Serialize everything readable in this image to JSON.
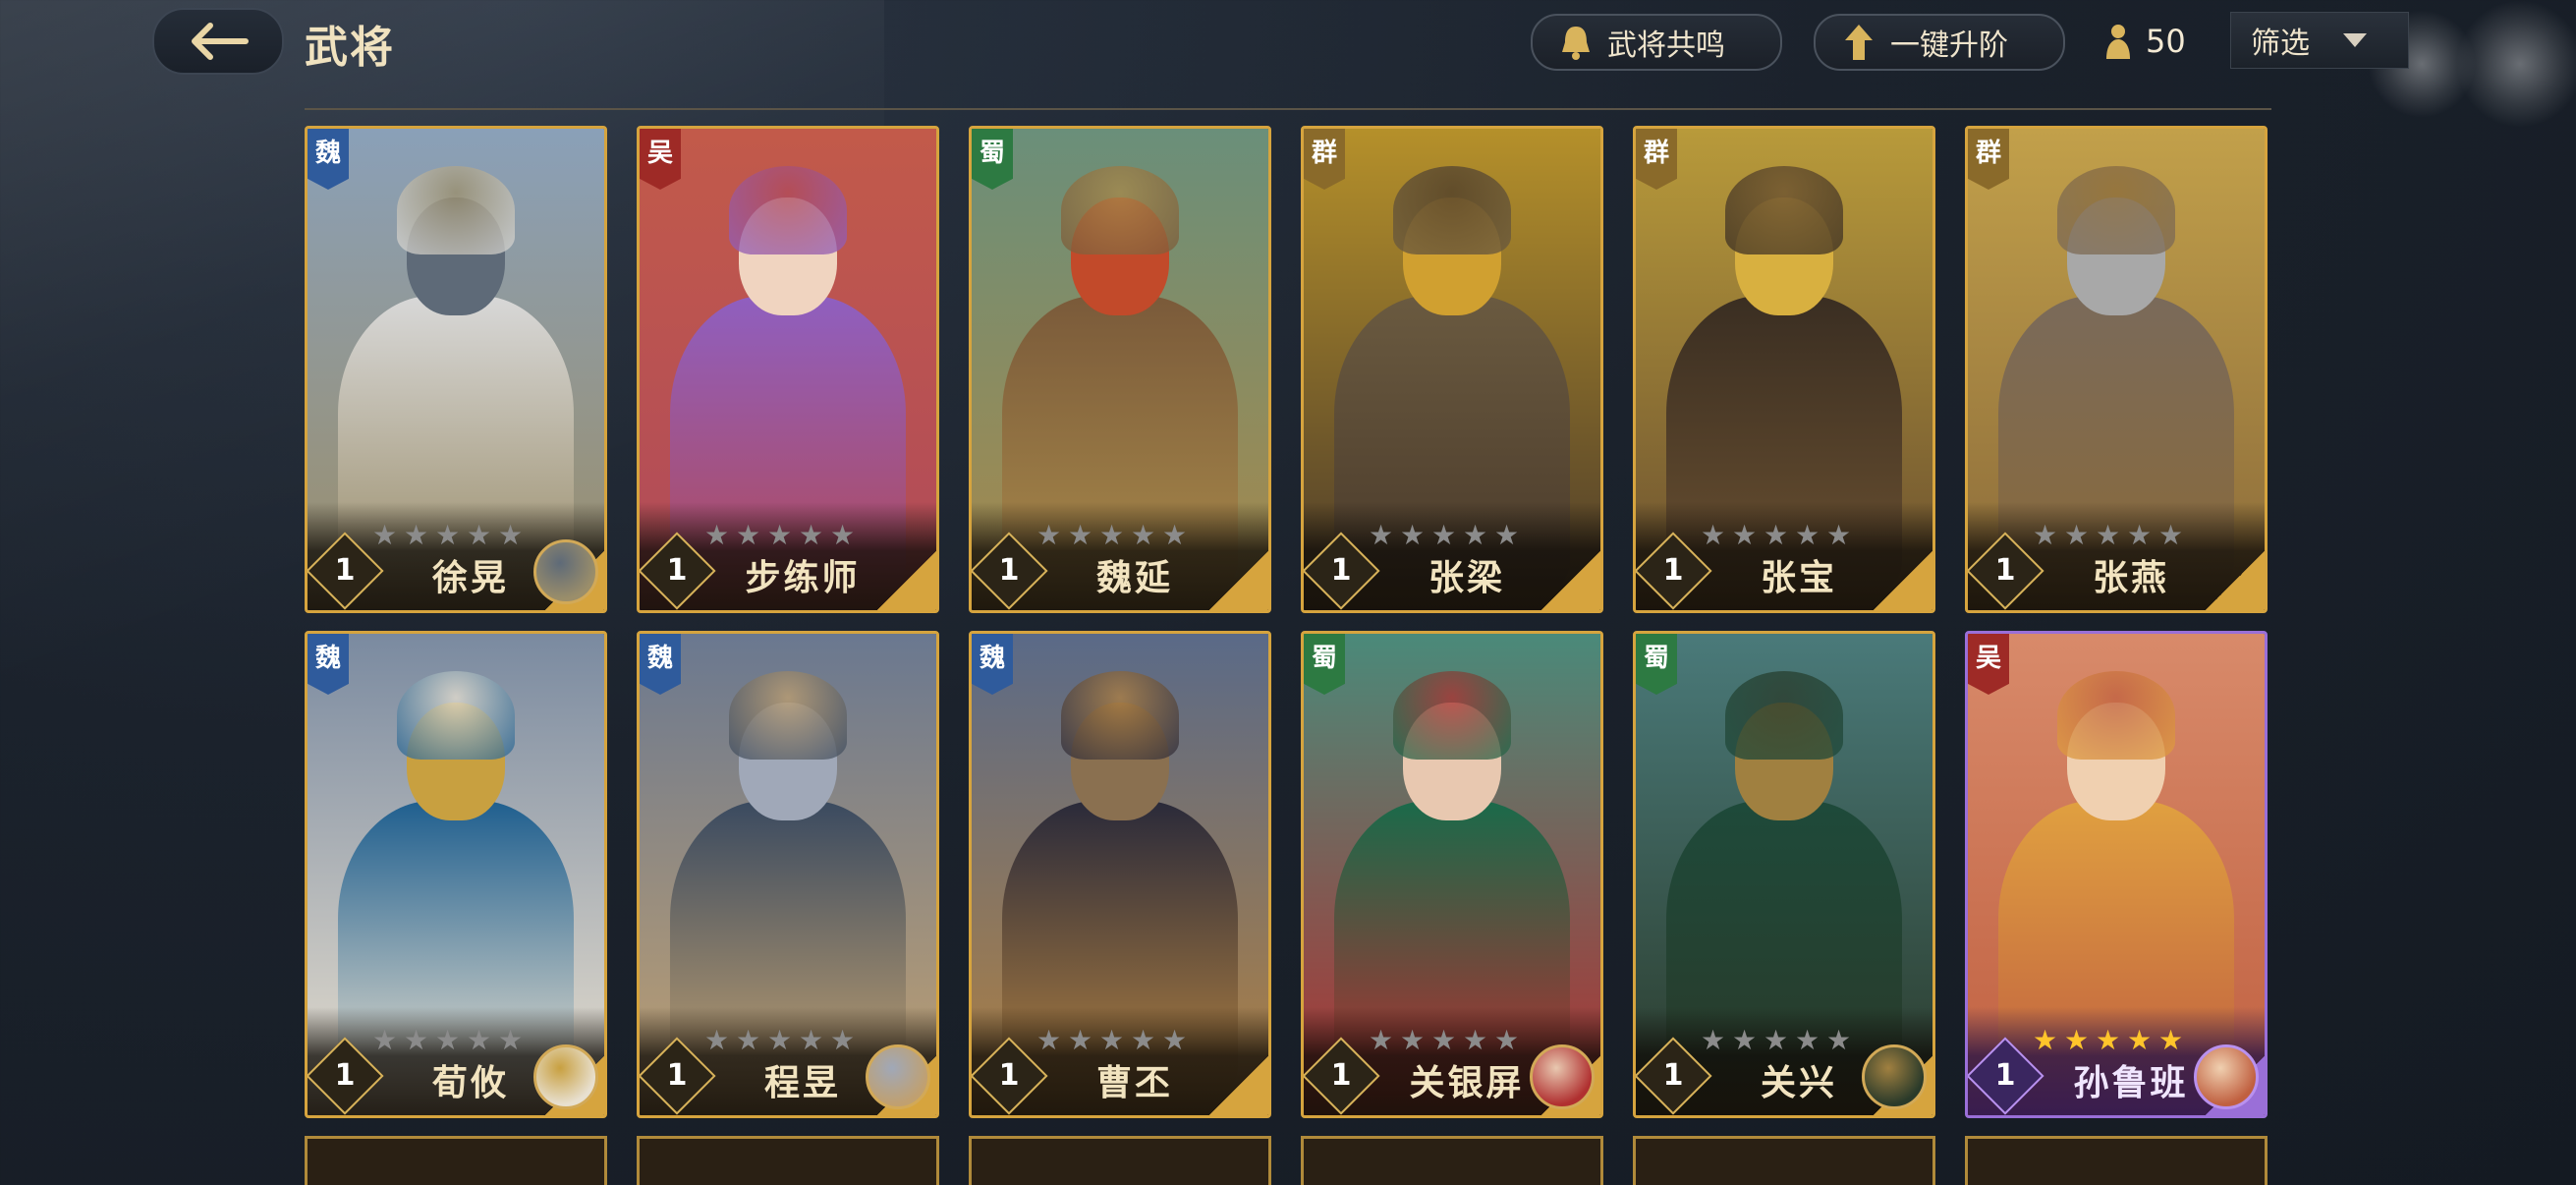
{
  "header": {
    "title": "武将",
    "resonance_label": "武将共鸣",
    "upgrade_label": "一键升阶",
    "coin_count": "50",
    "filter_label": "筛选"
  },
  "colors": {
    "wei": "#2f5b9c",
    "wu": "#9e2a26",
    "shu": "#2d7a42",
    "qun": "#8a6a2a",
    "gold_frame": "#d6a43e",
    "purple_frame": "#9a6fd8",
    "star_on": "#ffc42b"
  },
  "cards": [
    {
      "name": "徐晃",
      "faction": "魏",
      "faction_key": "wei",
      "level": "1",
      "stars": 0,
      "rarity": "gold",
      "skill": true
    },
    {
      "name": "步练师",
      "faction": "吴",
      "faction_key": "wu",
      "level": "1",
      "stars": 0,
      "rarity": "gold",
      "skill": false
    },
    {
      "name": "魏延",
      "faction": "蜀",
      "faction_key": "shu",
      "level": "1",
      "stars": 0,
      "rarity": "gold",
      "skill": false
    },
    {
      "name": "张梁",
      "faction": "群",
      "faction_key": "qun",
      "level": "1",
      "stars": 0,
      "rarity": "gold",
      "skill": false
    },
    {
      "name": "张宝",
      "faction": "群",
      "faction_key": "qun",
      "level": "1",
      "stars": 0,
      "rarity": "gold",
      "skill": false
    },
    {
      "name": "张燕",
      "faction": "群",
      "faction_key": "qun",
      "level": "1",
      "stars": 0,
      "rarity": "gold",
      "skill": false
    },
    {
      "name": "荀攸",
      "faction": "魏",
      "faction_key": "wei",
      "level": "1",
      "stars": 0,
      "rarity": "gold",
      "skill": true
    },
    {
      "name": "程昱",
      "faction": "魏",
      "faction_key": "wei",
      "level": "1",
      "stars": 0,
      "rarity": "gold",
      "skill": true
    },
    {
      "name": "曹丕",
      "faction": "魏",
      "faction_key": "wei",
      "level": "1",
      "stars": 0,
      "rarity": "gold",
      "skill": false
    },
    {
      "name": "关银屏",
      "faction": "蜀",
      "faction_key": "shu",
      "level": "1",
      "stars": 0,
      "rarity": "gold",
      "skill": true
    },
    {
      "name": "关兴",
      "faction": "蜀",
      "faction_key": "shu",
      "level": "1",
      "stars": 0,
      "rarity": "gold",
      "skill": true
    },
    {
      "name": "孙鲁班",
      "faction": "吴",
      "faction_key": "wu",
      "level": "1",
      "stars": 5,
      "rarity": "purple",
      "skill": true
    }
  ],
  "max_stars": 5
}
